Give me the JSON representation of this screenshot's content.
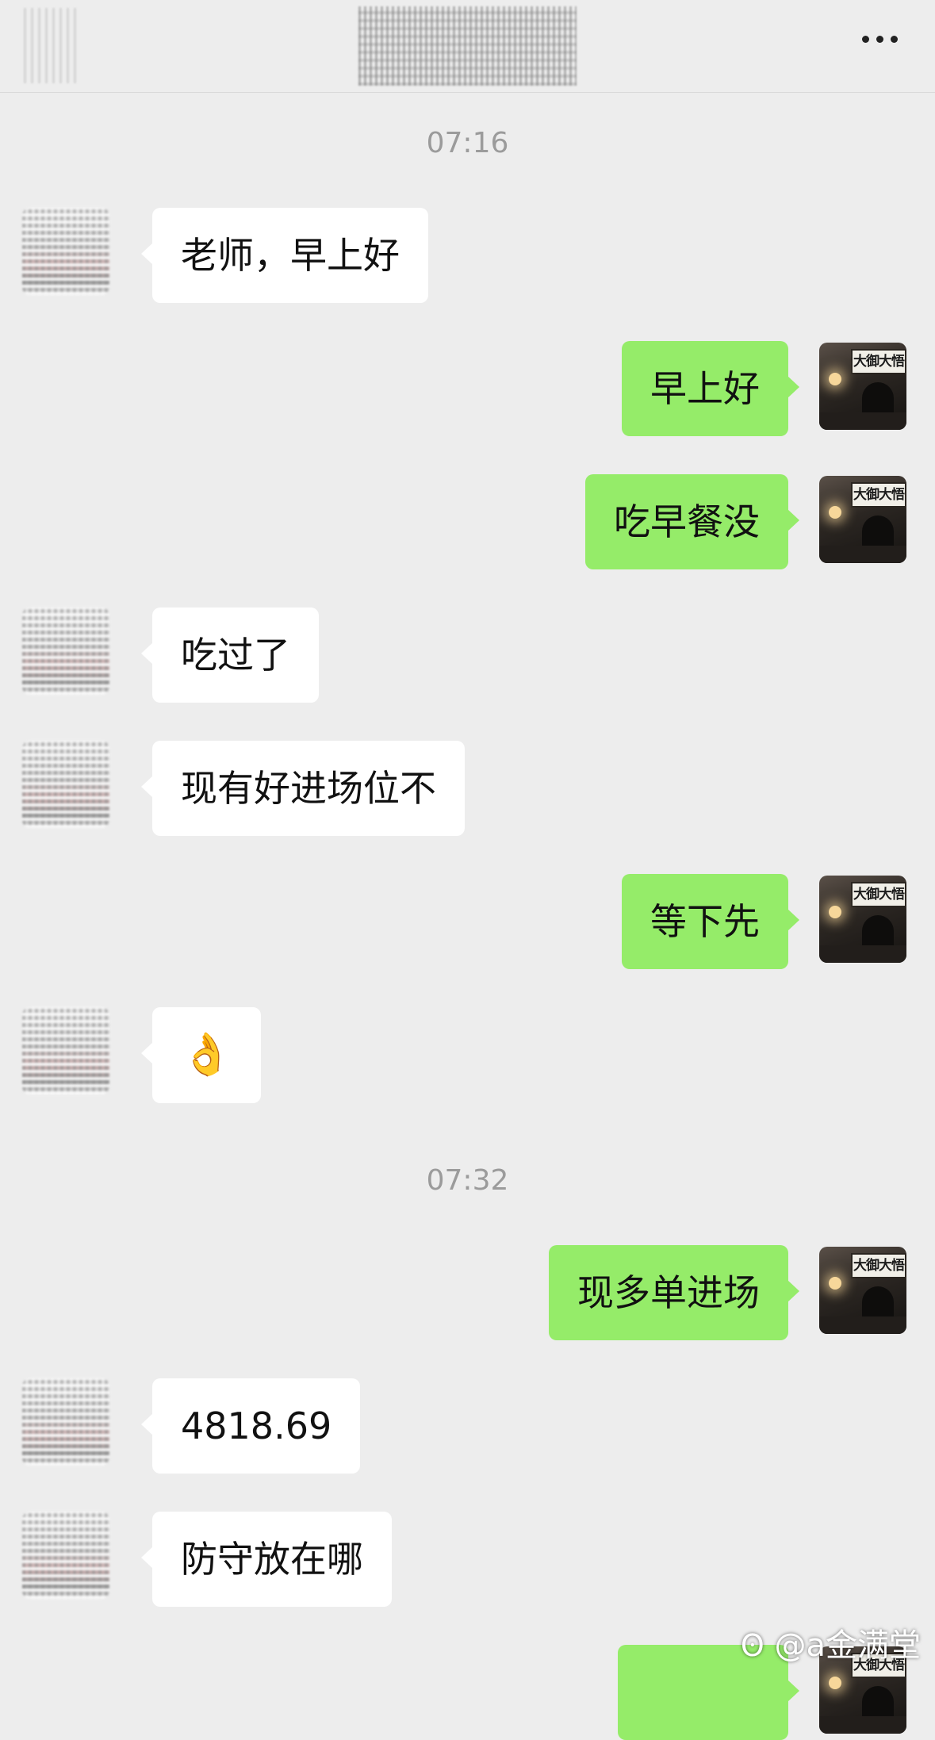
{
  "header": {
    "more_icon": "more-icon"
  },
  "messages": [
    {
      "type": "time",
      "text": "07:16"
    },
    {
      "type": "in",
      "text": "老师，早上好"
    },
    {
      "type": "out",
      "text": "早上好"
    },
    {
      "type": "out",
      "text": "吃早餐没"
    },
    {
      "type": "in",
      "text": "吃过了"
    },
    {
      "type": "in",
      "text": "现有好进场位不"
    },
    {
      "type": "out",
      "text": "等下先"
    },
    {
      "type": "in",
      "text": "👌"
    },
    {
      "type": "time",
      "text": "07:32"
    },
    {
      "type": "out",
      "text": "现多单进场"
    },
    {
      "type": "in",
      "text": "4818.69"
    },
    {
      "type": "in",
      "text": "防守放在哪"
    },
    {
      "type": "out",
      "text": ""
    }
  ],
  "avatar_sign": "大御大悟",
  "watermark": {
    "icon": "weibo-logo-icon",
    "text": "@a金满堂"
  }
}
